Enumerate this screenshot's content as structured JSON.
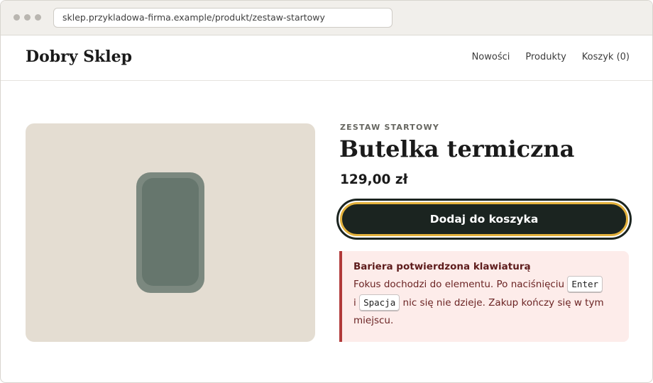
{
  "browser": {
    "url": "sklep.przykladowa-firma.example/produkt/zestaw-startowy"
  },
  "site": {
    "logo": "Dobry Sklep",
    "nav": [
      "Nowości",
      "Produkty",
      "Koszyk (0)"
    ]
  },
  "product": {
    "overline": "ZESTAW STARTOWY",
    "title": "Butelka termiczna",
    "price": "129,00 zł",
    "add_to_cart_label": "Dodaj do koszyka"
  },
  "alert": {
    "title": "Bariera potwierdzona klawiaturą",
    "text_1": "Fokus dochodzi do elementu. Po naciśnięciu",
    "key_1": "Enter",
    "text_2": "i",
    "key_2": "Spacja",
    "text_3": "nic się nie dzieje. Zakup kończy się w tym miejscu."
  },
  "colors": {
    "accent_dark": "#1b2420",
    "focus_ring": "#e3b13c",
    "alert_border": "#b13a3a",
    "alert_bg": "#fdecea"
  },
  "icons": [
    "window-dot-icon",
    "product-bottle-image"
  ]
}
